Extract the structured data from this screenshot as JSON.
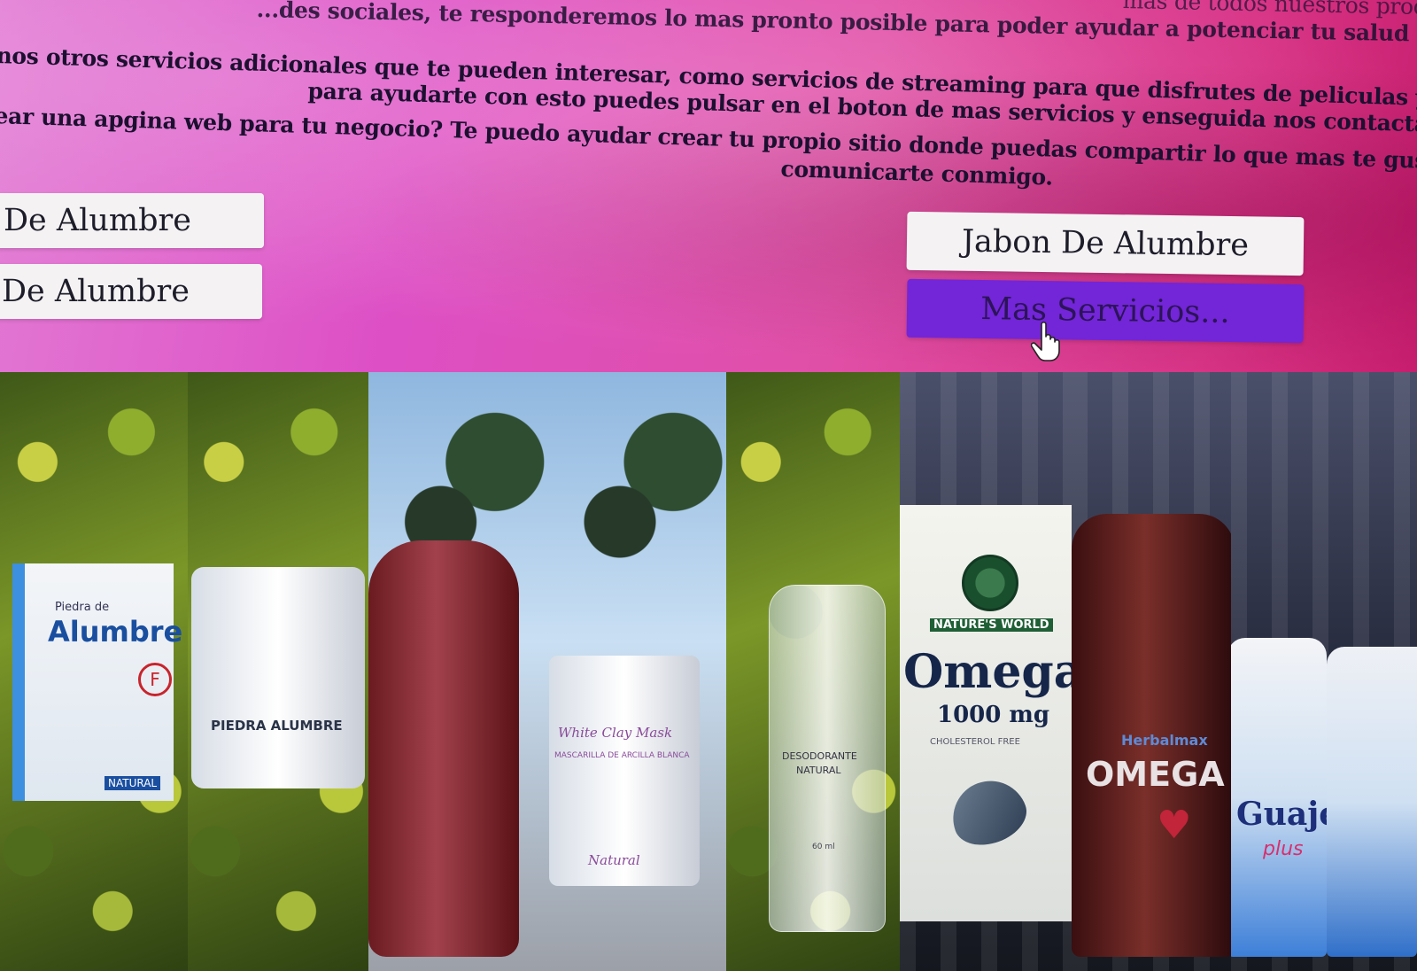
{
  "hero": {
    "lines": [
      "...des sociales, te responderemos lo mas pronto posible para poder ayudar a potenciar tu salud de una ma",
      "nos otros servicios adicionales que te pueden interesar, como servicios de streaming para que disfrutes de peliculas y series, s",
      "para ayudarte con esto puedes pulsar en el boton de mas servicios y enseguida nos contactaremos c",
      "ear una apgina web para tu negocio? Te puedo ayudar crear tu propio sitio donde puedas compartir lo que mas te guste hacer, d",
      "comunicarte conmigo."
    ],
    "top_right_fragment": "mas de todos nuestros prod"
  },
  "buttons": {
    "left_1": "De Alumbre",
    "left_2": "De Alumbre",
    "right_1": "Jabon De Alumbre",
    "right_2": "Mas Servicios..."
  },
  "products": {
    "alumbre_box": {
      "small": "Piedra de",
      "brand": "Alumbre",
      "badge": "F",
      "footer": "NATURAL"
    },
    "alumbre_jar": {
      "label": "PIEDRA ALUMBRE"
    },
    "clay_mask": {
      "title": "White Clay Mask",
      "subtitle": "MASCARILLA DE ARCILLA BLANCA",
      "footer": "Natural"
    },
    "spray": {
      "line1": "DESODORANTE",
      "line2": "NATURAL",
      "volume": "60 ml"
    },
    "omega_box": {
      "brand": "NATURE'S WORLD",
      "name": "Omega",
      "dose": "1000 mg",
      "claim": "CHOLESTEROL FREE"
    },
    "omega_bottle": {
      "brand": "Herbalmax",
      "name": "OMEGA"
    },
    "guaje": {
      "name": "Guaje",
      "variant": "plus"
    }
  },
  "colors": {
    "button_bg": "#f5f2f4",
    "button_accent": "#7325d8",
    "hero_pink": "#e04fa6"
  }
}
